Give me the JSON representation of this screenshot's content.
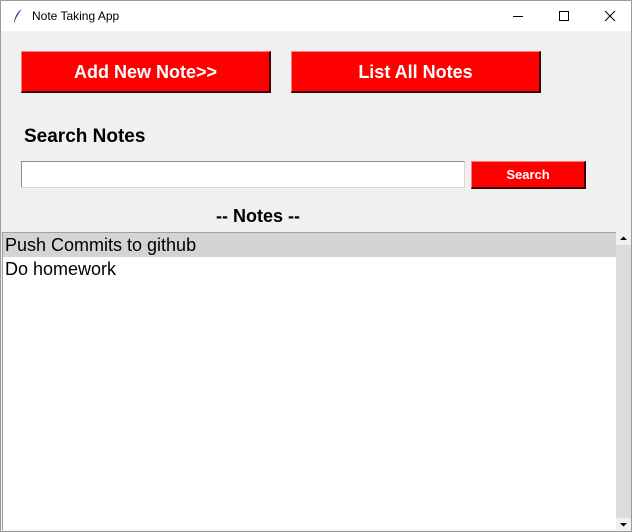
{
  "window": {
    "title": "Note Taking App",
    "icon": "feather-icon",
    "controls": [
      "minimize-icon",
      "maximize-icon",
      "close-icon"
    ]
  },
  "toolbar": {
    "add_label": "Add New Note>>",
    "list_label": "List All Notes"
  },
  "search": {
    "heading": "Search Notes",
    "value": "",
    "placeholder": "",
    "button_label": "Search"
  },
  "notes": {
    "heading": "-- Notes --",
    "items": [
      {
        "text": "Push Commits to github",
        "selected": true
      },
      {
        "text": "Do homework",
        "selected": false
      }
    ]
  },
  "colors": {
    "button_bg": "#ff0000",
    "button_text": "#ffffff",
    "window_bg": "#f0f0f0",
    "selection_bg": "#d4d4d4"
  }
}
